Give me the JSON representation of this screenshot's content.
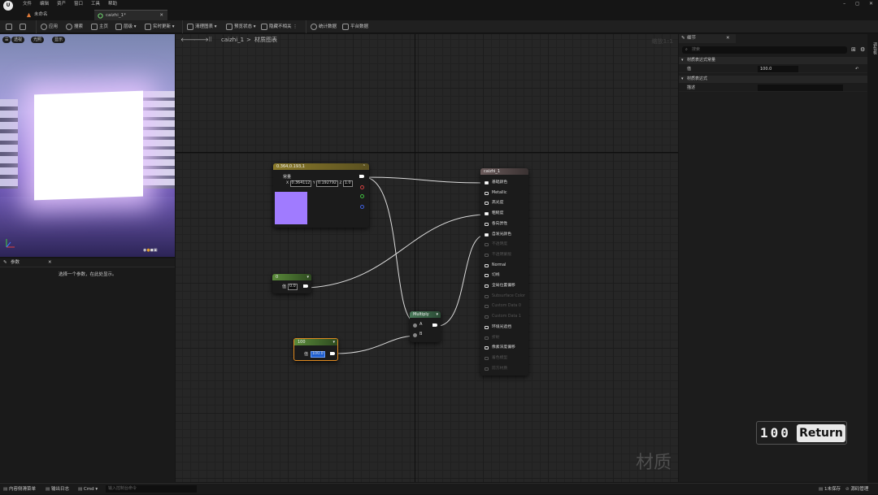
{
  "menu": {
    "logo": "U",
    "items": [
      "文件",
      "编辑",
      "资产",
      "窗口",
      "工具",
      "帮助"
    ]
  },
  "window_controls": [
    "–",
    "◻",
    "✕"
  ],
  "tabs": [
    {
      "label": "未命名",
      "active": false
    },
    {
      "label": "caizhi_1*",
      "active": true,
      "close": "✕"
    }
  ],
  "toolbar": {
    "apply": "应用",
    "search": "搜索",
    "home": "主页",
    "hierarchy": "层级",
    "live_update": "实时更新",
    "clean_graph": "清理图表",
    "preview_state": "预览状态",
    "hide_unrelated": "隐藏不相关",
    "stats": "统计数据",
    "platform_stats": "平台数据"
  },
  "viewport": {
    "buttons": [
      "透视",
      "光照",
      "显示"
    ]
  },
  "params_panel": {
    "title": "参数",
    "close": "✕",
    "message": "选择一个参数，在此处显示。"
  },
  "graph": {
    "breadcrumb_asset": "caizhi_1",
    "breadcrumb_sep": ">",
    "breadcrumb_graph": "材质图表",
    "zoom": "缩放1:1",
    "watermark": "材质",
    "nodes": {
      "vector": {
        "title": "0.364,0.193,1",
        "label": "常量",
        "x_label": "X",
        "x": "0.364112",
        "y_label": "Y",
        "y": "0.192792",
        "z_label": "Z",
        "z": "1.0",
        "swatch": "#a07bff"
      },
      "scalar1": {
        "title": "0",
        "value_label": "值",
        "value": "0.0"
      },
      "scalar100": {
        "title": "100",
        "value_label": "值",
        "value": "100.0"
      },
      "multiply": {
        "title": "Multiply",
        "a": "A",
        "b": "B"
      },
      "result": {
        "title": "caizhi_1",
        "outputs": [
          {
            "label": "基础颜色",
            "state": "on"
          },
          {
            "label": "Metallic",
            "state": "normal"
          },
          {
            "label": "高光度",
            "state": "normal"
          },
          {
            "label": "粗糙度",
            "state": "on"
          },
          {
            "label": "各向异性",
            "state": "normal"
          },
          {
            "label": "自发光颜色",
            "state": "on"
          },
          {
            "label": "不透明度",
            "state": "off"
          },
          {
            "label": "不透明蒙版",
            "state": "off"
          },
          {
            "label": "Normal",
            "state": "normal"
          },
          {
            "label": "切线",
            "state": "normal"
          },
          {
            "label": "全局位置偏移",
            "state": "normal"
          },
          {
            "label": "Subsurface Color",
            "state": "off"
          },
          {
            "label": "Custom Data 0",
            "state": "off"
          },
          {
            "label": "Custom Data 1",
            "state": "off"
          },
          {
            "label": "环境光遮挡",
            "state": "normal"
          },
          {
            "label": "折射",
            "state": "off"
          },
          {
            "label": "像素深度偏移",
            "state": "normal"
          },
          {
            "label": "着色模型",
            "state": "off"
          },
          {
            "label": "前方材质",
            "state": "off"
          }
        ]
      }
    }
  },
  "details": {
    "title": "细节",
    "close": "✕",
    "search_placeholder": "搜索",
    "section1": "材质表达式常量",
    "prop_value_label": "值",
    "prop_value": "100.0",
    "reset_icon": "↶",
    "section2": "材质表达式",
    "prop_desc_label": "描述",
    "side_tab": "调色板"
  },
  "keycast": {
    "num": "100",
    "key": "Return"
  },
  "statusbar": {
    "drawer": "内容侧滑菜单",
    "output_log": "输出日志",
    "cmd": "Cmd",
    "cmd_placeholder": "输入控制台命令",
    "unsaved": "1未保存",
    "source_control": "源码管理"
  }
}
